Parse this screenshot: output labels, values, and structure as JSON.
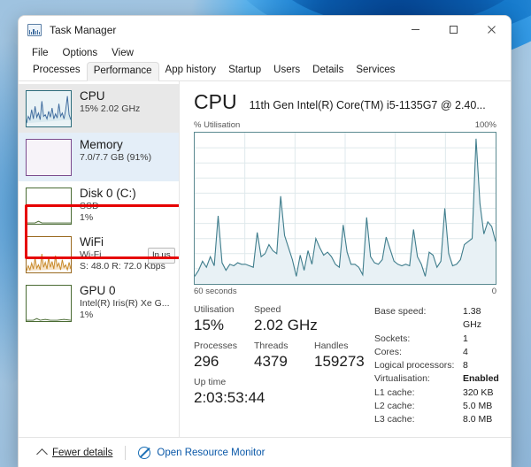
{
  "window": {
    "title": "Task Manager",
    "icon": "task-manager-icon",
    "controls": {
      "minimize": "–",
      "maximize": "□",
      "close": "✕"
    }
  },
  "menubar": {
    "items": [
      "File",
      "Options",
      "View"
    ]
  },
  "tabs": [
    {
      "label": "Processes",
      "active": false
    },
    {
      "label": "Performance",
      "active": true
    },
    {
      "label": "App history",
      "active": false
    },
    {
      "label": "Startup",
      "active": false
    },
    {
      "label": "Users",
      "active": false
    },
    {
      "label": "Details",
      "active": false
    },
    {
      "label": "Services",
      "active": false
    }
  ],
  "sidebar": {
    "items": [
      {
        "name": "CPU",
        "title": "CPU",
        "sub1": "15%  2.02 GHz",
        "sub2": "",
        "state": "selected"
      },
      {
        "name": "Memory",
        "title": "Memory",
        "sub1": "7.0/7.7 GB (91%)",
        "sub2": "",
        "state": "highlighted"
      },
      {
        "name": "Disk 0 (C:)",
        "title": "Disk 0 (C:)",
        "sub1": "SSD",
        "sub2": "1%",
        "state": "normal"
      },
      {
        "name": "WiFi",
        "title": "WiFi",
        "sub1": "Wi-Fi",
        "sub2": "S: 48.0 R: 72.0 Kbps",
        "state": "normal"
      },
      {
        "name": "GPU 0",
        "title": "GPU 0",
        "sub1": "Intel(R) Iris(R) Xe G...",
        "sub2": "1%",
        "state": "normal"
      }
    ],
    "tooltip_fragment": "In us"
  },
  "main": {
    "heading": "CPU",
    "model": "11th Gen Intel(R) Core(TM) i5-1135G7 @ 2.40...",
    "graph_top_left": "% Utilisation",
    "graph_top_right": "100%",
    "graph_bottom_left": "60 seconds",
    "graph_bottom_right": "0",
    "stats_left": [
      {
        "label": "Utilisation",
        "value": "15%"
      },
      {
        "label": "Speed",
        "value": "2.02 GHz"
      },
      {
        "label": "Processes",
        "value": "296"
      },
      {
        "label": "Threads",
        "value": "4379"
      },
      {
        "label": "Handles",
        "value": "159273"
      },
      {
        "label": "Up time",
        "value": "2:03:53:44"
      }
    ],
    "stats_right": [
      {
        "label": "Base speed:",
        "value": "1.38 GHz",
        "bold": false
      },
      {
        "label": "Sockets:",
        "value": "1",
        "bold": false
      },
      {
        "label": "Cores:",
        "value": "4",
        "bold": false
      },
      {
        "label": "Logical processors:",
        "value": "8",
        "bold": false
      },
      {
        "label": "Virtualisation:",
        "value": "Enabled",
        "bold": true
      },
      {
        "label": "L1 cache:",
        "value": "320 KB",
        "bold": false
      },
      {
        "label": "L2 cache:",
        "value": "5.0 MB",
        "bold": false
      },
      {
        "label": "L3 cache:",
        "value": "8.0 MB",
        "bold": false
      }
    ]
  },
  "statusbar": {
    "fewer_details": "Fewer details",
    "open_resource_monitor": "Open Resource Monitor"
  },
  "colors": {
    "cpu_line": "#3f7d8c",
    "cpu_fill": "#e8f1f5",
    "graph_border": "#5b8a91",
    "accent_link": "#0a58a8",
    "annotation_red": "#e60000",
    "selection_grey": "#e8e8e8",
    "selection_blue": "#e4eef8"
  },
  "chart_data": {
    "type": "area",
    "title": "% Utilisation",
    "xlabel": "60 seconds",
    "ylabel": "% Utilisation",
    "xlim": [
      60,
      0
    ],
    "ylim": [
      0,
      100
    ],
    "grid": true,
    "grid_divisions": {
      "x": 6,
      "y": 10
    },
    "series": [
      {
        "name": "CPU utilisation",
        "values": [
          5,
          9,
          15,
          11,
          18,
          12,
          45,
          14,
          9,
          13,
          12,
          14,
          13,
          13,
          12,
          11,
          34,
          18,
          20,
          26,
          22,
          20,
          58,
          32,
          24,
          16,
          5,
          19,
          9,
          22,
          13,
          30,
          24,
          19,
          21,
          18,
          13,
          11,
          39,
          21,
          13,
          13,
          11,
          6,
          44,
          18,
          14,
          13,
          16,
          31,
          23,
          15,
          13,
          12,
          13,
          12,
          36,
          18,
          13,
          5,
          21,
          19,
          11,
          15,
          50,
          20,
          12,
          13,
          16,
          26,
          28,
          30,
          96,
          53,
          33,
          41,
          38,
          28
        ]
      }
    ]
  }
}
